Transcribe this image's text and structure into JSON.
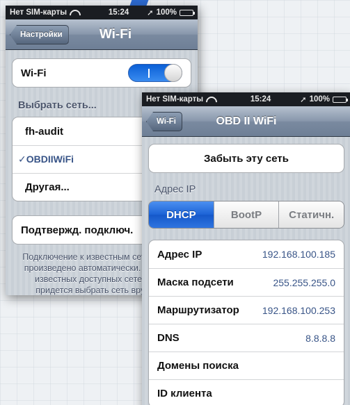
{
  "back_screen": {
    "status": {
      "carrier": "Нет SIM-карты",
      "time": "15:24",
      "battery": "100%"
    },
    "nav": {
      "back_label": "Настройки",
      "title": "Wi-Fi"
    },
    "wifi_row": {
      "label": "Wi-Fi",
      "enabled": true
    },
    "choose_network_header": "Выбрать сеть...",
    "networks": [
      {
        "name": "fh-audit",
        "selected": false
      },
      {
        "name": "OBDIIWiFi",
        "selected": true,
        "check": "✓"
      },
      {
        "name": "Другая...",
        "selected": false
      }
    ],
    "ask_to_join": {
      "label": "Подтвержд. подключ.",
      "enabled": true
    },
    "footer_lines": [
      "Подключение к известным сетям будет",
      "произведено автоматически. Если нет",
      "известных доступных сетей, Вам",
      "придется выбрать сеть вручную."
    ]
  },
  "front_screen": {
    "status": {
      "carrier": "Нет SIM-карты",
      "time": "15:24",
      "battery": "100%"
    },
    "nav": {
      "back_label": "Wi-Fi",
      "title": "OBD II WiFi"
    },
    "forget_button": "Забыть эту сеть",
    "ip_header": "Адрес IP",
    "segments": [
      {
        "label": "DHCP",
        "active": true
      },
      {
        "label": "BootP",
        "active": false
      },
      {
        "label": "Статичн.",
        "active": false
      }
    ],
    "details": [
      {
        "label": "Адрес IP",
        "value": "192.168.100.185"
      },
      {
        "label": "Маска подсети",
        "value": "255.255.255.0"
      },
      {
        "label": "Маршрутизатор",
        "value": "192.168.100.253"
      },
      {
        "label": "DNS",
        "value": "8.8.8.8"
      },
      {
        "label": "Домены поиска",
        "value": ""
      },
      {
        "label": "ID клиента",
        "value": ""
      }
    ]
  }
}
